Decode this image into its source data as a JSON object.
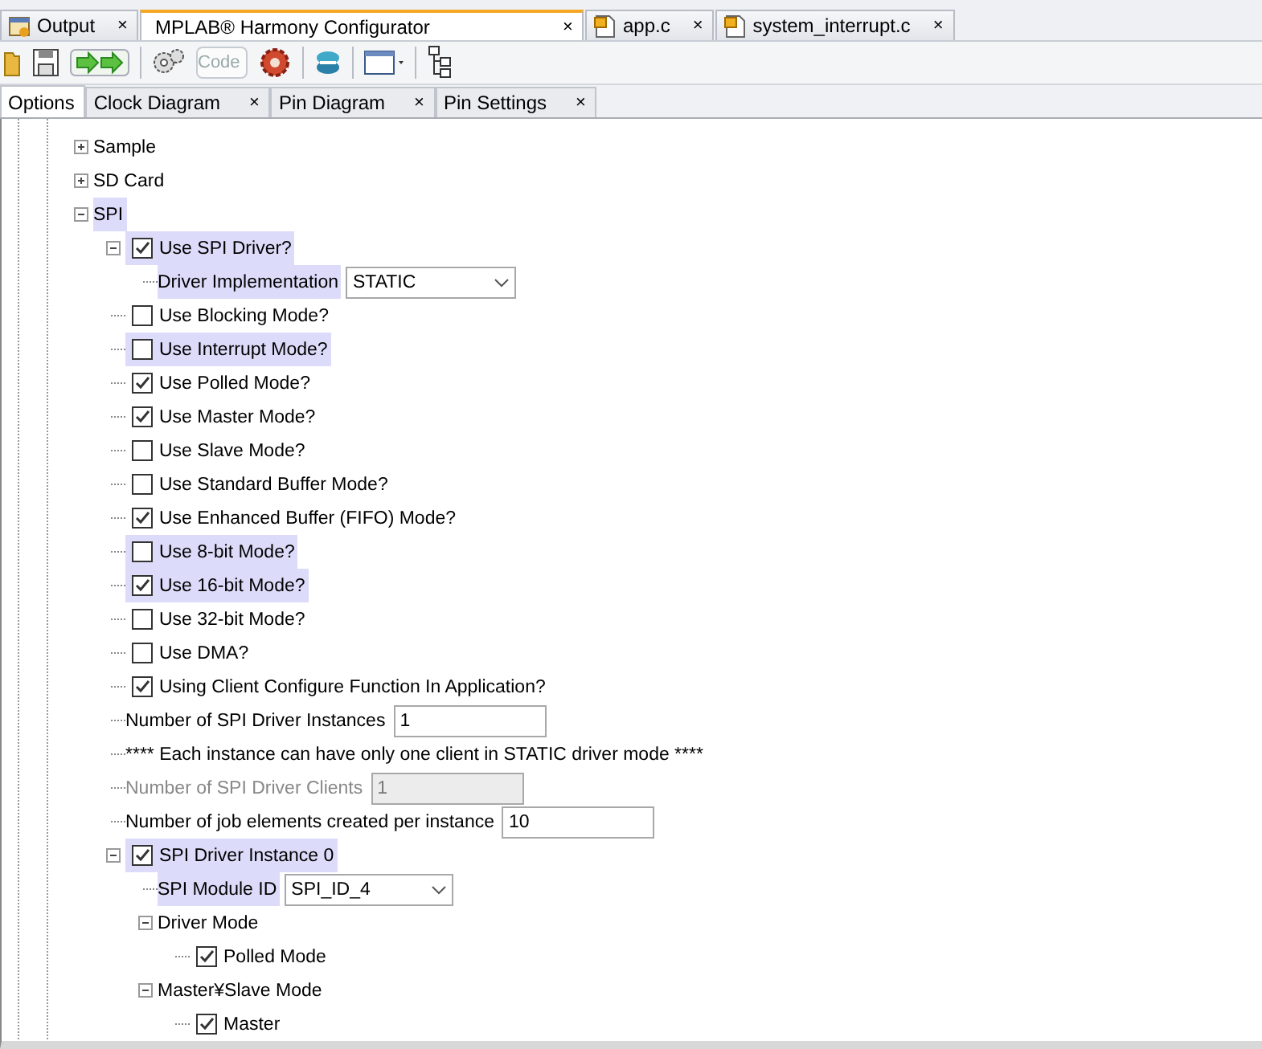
{
  "editor_tabs": [
    {
      "label": "Output",
      "selected": false,
      "close": "×"
    },
    {
      "label": "MPLAB® Harmony Configurator",
      "selected": true,
      "close": "×"
    },
    {
      "label": "app.c",
      "selected": false,
      "close": "×"
    },
    {
      "label": "system_interrupt.c",
      "selected": false,
      "close": "×"
    }
  ],
  "toolbar": {
    "code_button": "Code"
  },
  "config_tabs": [
    {
      "label": "Options",
      "selected": true
    },
    {
      "label": "Clock Diagram",
      "selected": false,
      "close": "×"
    },
    {
      "label": "Pin Diagram",
      "selected": false,
      "close": "×"
    },
    {
      "label": "Pin Settings",
      "selected": false,
      "close": "×"
    }
  ],
  "tree": [
    {
      "kind": "group",
      "label": "Sample",
      "expanded": false,
      "highlighted": false
    },
    {
      "kind": "group",
      "label": "SD Card",
      "expanded": false,
      "highlighted": false
    },
    {
      "kind": "group",
      "label": "SPI",
      "expanded": true,
      "highlighted": true,
      "children": [
        {
          "kind": "checkbox",
          "label": "Use SPI Driver?",
          "checked": true,
          "expanded": true,
          "highlighted": true,
          "children": [
            {
              "kind": "combo",
              "label": "Driver Implementation",
              "value": "STATIC",
              "highlighted": true
            }
          ]
        },
        {
          "kind": "checkbox",
          "label": "Use Blocking Mode?",
          "checked": false,
          "highlighted": false
        },
        {
          "kind": "checkbox",
          "label": "Use Interrupt Mode?",
          "checked": false,
          "highlighted": true
        },
        {
          "kind": "checkbox",
          "label": "Use Polled Mode?",
          "checked": true,
          "highlighted": false
        },
        {
          "kind": "checkbox",
          "label": "Use Master Mode?",
          "checked": true,
          "highlighted": false
        },
        {
          "kind": "checkbox",
          "label": "Use Slave Mode?",
          "checked": false,
          "highlighted": false
        },
        {
          "kind": "checkbox",
          "label": "Use Standard Buffer Mode?",
          "checked": false,
          "highlighted": false
        },
        {
          "kind": "checkbox",
          "label": "Use Enhanced Buffer (FIFO) Mode?",
          "checked": true,
          "highlighted": false
        },
        {
          "kind": "checkbox",
          "label": "Use 8-bit Mode?",
          "checked": false,
          "highlighted": true
        },
        {
          "kind": "checkbox",
          "label": "Use 16-bit Mode?",
          "checked": true,
          "highlighted": true
        },
        {
          "kind": "checkbox",
          "label": "Use 32-bit Mode?",
          "checked": false,
          "highlighted": false
        },
        {
          "kind": "checkbox",
          "label": "Use DMA?",
          "checked": false,
          "highlighted": false
        },
        {
          "kind": "checkbox",
          "label": "Using Client Configure Function In Application?",
          "checked": true,
          "highlighted": false
        },
        {
          "kind": "field",
          "label": "Number of SPI Driver Instances",
          "value": "1",
          "disabled": false,
          "highlighted": false
        },
        {
          "kind": "note",
          "label": "**** Each instance can have only one client in STATIC driver mode ****",
          "highlighted": false
        },
        {
          "kind": "field",
          "label": "Number of SPI Driver Clients",
          "value": "1",
          "disabled": true,
          "highlighted": false
        },
        {
          "kind": "field",
          "label": "Number of job elements created per instance",
          "value": "10",
          "disabled": false,
          "highlighted": false
        },
        {
          "kind": "checkbox",
          "label": "SPI Driver Instance 0",
          "checked": true,
          "expanded": true,
          "highlighted": true,
          "children": [
            {
              "kind": "combo",
              "label": "SPI Module ID",
              "value": "SPI_ID_4",
              "highlighted": true
            },
            {
              "kind": "group",
              "label": "Driver Mode",
              "expanded": true,
              "highlighted": false,
              "children": [
                {
                  "kind": "checkbox",
                  "label": "Polled Mode",
                  "checked": true,
                  "highlighted": false
                }
              ]
            },
            {
              "kind": "group",
              "label": "Master¥Slave Mode",
              "expanded": true,
              "highlighted": false,
              "children": [
                {
                  "kind": "checkbox",
                  "label": "Master",
                  "checked": true,
                  "highlighted": false
                }
              ]
            }
          ]
        }
      ]
    }
  ]
}
